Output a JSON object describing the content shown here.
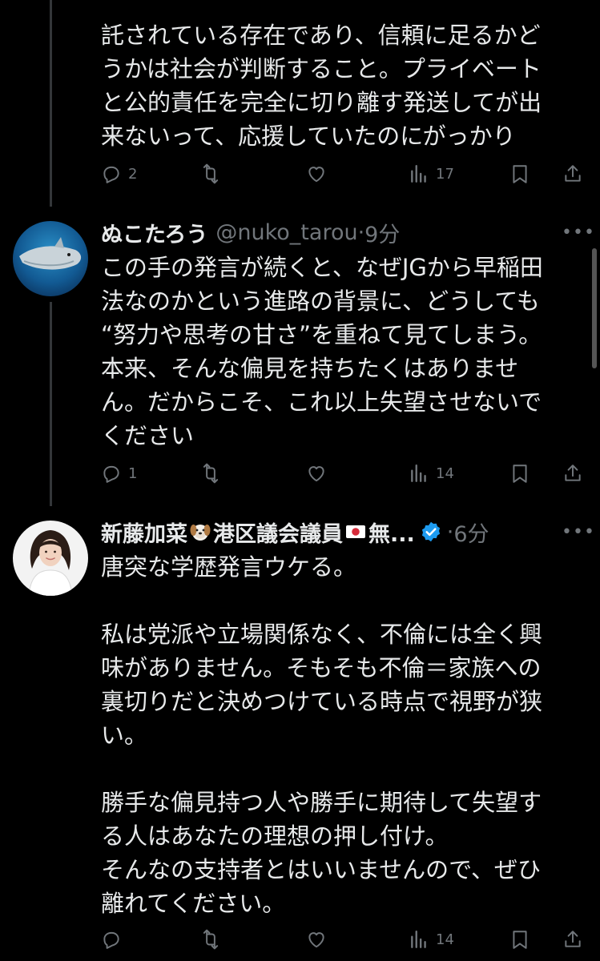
{
  "tweets": [
    {
      "body": "託されている存在であり、信頼に足るかど\nうかは社会が判断すること。プライベート\nと公的責任を完全に切り離す発送してが出\n来ないって、応援していたのにがっかり",
      "replies": "2",
      "retweets": "",
      "likes": "",
      "views": "17"
    },
    {
      "name": "ぬこたろう",
      "handle": "@nuko_tarou",
      "dot": "·",
      "time": "9分",
      "body": "この手の発言が続くと、なぜJGから早稲田\n法なのかという進路の背景に、どうしても\n“努力や思考の甘さ”を重ねて見てしまう。\n本来、そんな偏見を持ちたくはありませ\nん。だからこそ、これ以上失望させないで\nください",
      "replies": "1",
      "retweets": "",
      "likes": "",
      "views": "14"
    },
    {
      "name_part1": "新藤加菜",
      "name_part2": "港区議会議員",
      "name_part3": "無...",
      "dot": "·",
      "time": "6分",
      "body": "唐突な学歴発言ウケる。\n\n私は党派や立場関係なく、不倫には全く興\n味がありません。そもそも不倫＝家族への\n裏切りだと決めつけている時点で視野が狭\nい。\n\n勝手な偏見持つ人や勝手に期待して失望す\nる人はあなたの理想の押し付け。\nそんなの支持者とはいいませんので、ぜひ\n離れてください。",
      "replies": "",
      "retweets": "",
      "likes": "",
      "views": "14"
    }
  ],
  "icons": {
    "reply": "reply-icon",
    "retweet": "retweet-icon",
    "like": "heart-icon",
    "views": "views-bar-chart-icon",
    "bookmark": "bookmark-icon",
    "share": "share-icon",
    "more": "more-icon",
    "verified": "verified-badge-icon"
  },
  "colors": {
    "background": "#000000",
    "text": "#e7e9ea",
    "muted": "#71767b",
    "verified": "#1d9bf0"
  }
}
